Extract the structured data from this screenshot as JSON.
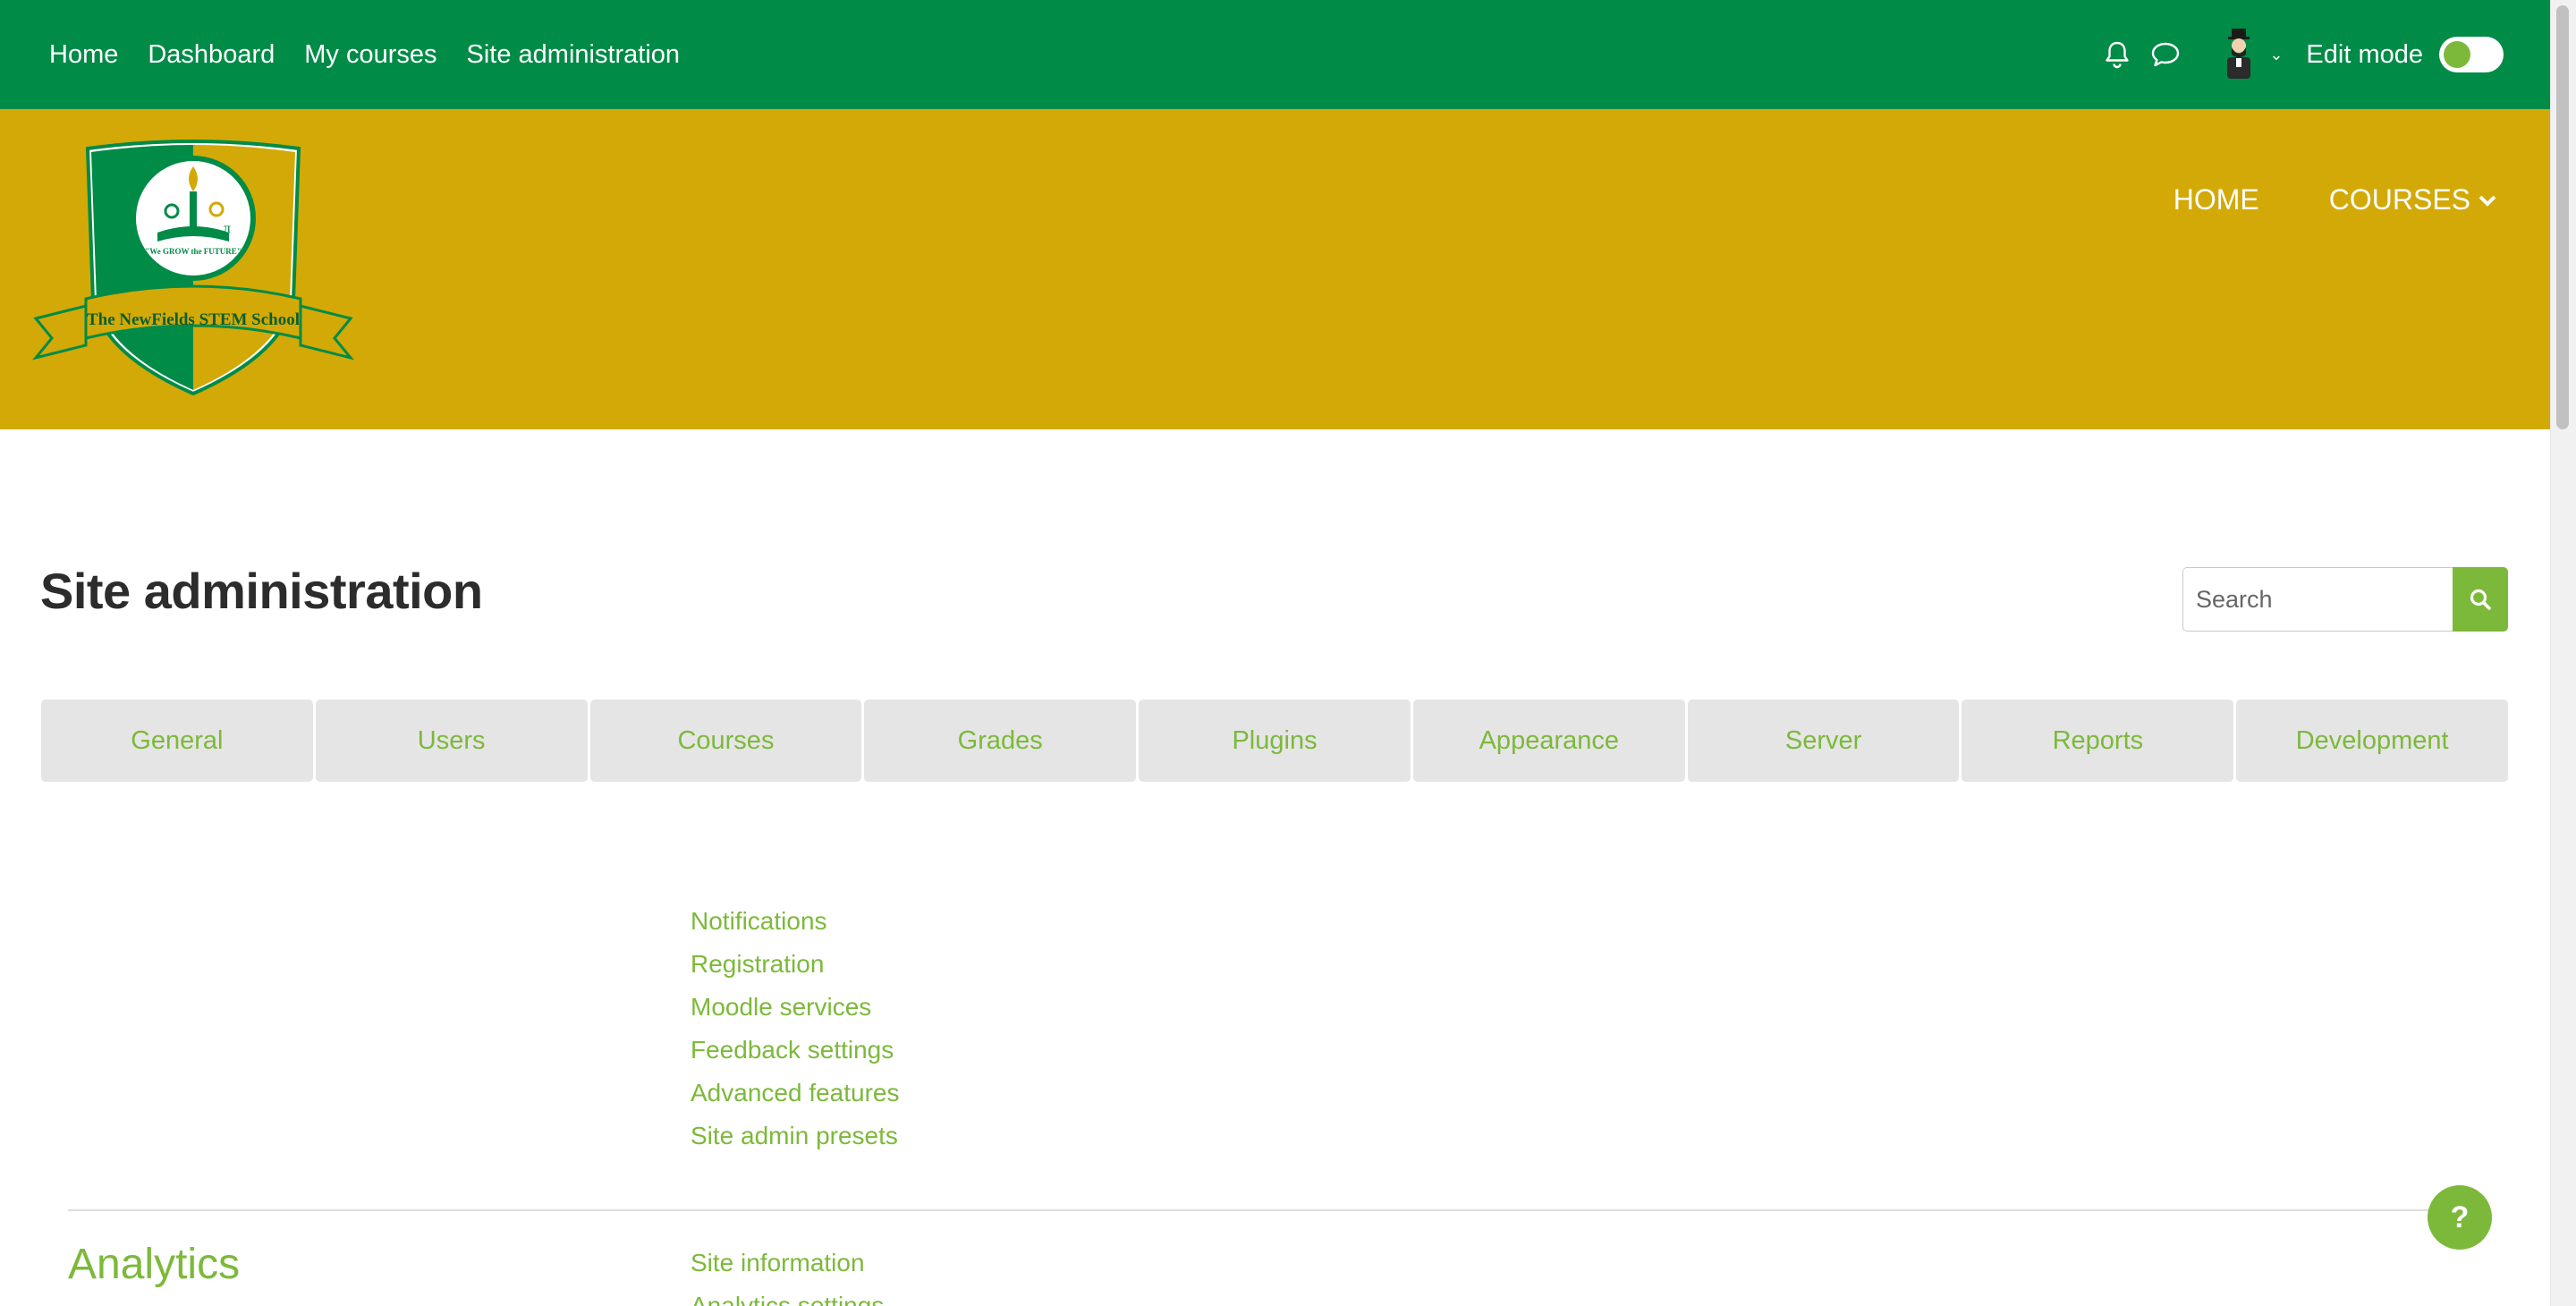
{
  "topnav": {
    "items": [
      "Home",
      "Dashboard",
      "My courses",
      "Site administration"
    ],
    "edit_mode_label": "Edit mode",
    "edit_mode_on": false
  },
  "banner": {
    "nav": [
      "HOME",
      "COURSES"
    ],
    "logo_text": "The NewFields STEM School",
    "logo_motto": "\"We GROW the FUTURE\""
  },
  "page": {
    "title": "Site administration",
    "search_placeholder": "Search"
  },
  "tabs": [
    "General",
    "Users",
    "Courses",
    "Grades",
    "Plugins",
    "Appearance",
    "Server",
    "Reports",
    "Development"
  ],
  "general_links": [
    "Notifications",
    "Registration",
    "Moodle services",
    "Feedback settings",
    "Advanced features",
    "Site admin presets"
  ],
  "analytics": {
    "title": "Analytics",
    "links": [
      "Site information",
      "Analytics settings"
    ]
  },
  "help_button": "?",
  "colors": {
    "navbar": "#008b47",
    "banner": "#d2a907",
    "accent": "#7cb93a",
    "tab_bg": "#e5e5e5"
  },
  "icons": [
    "bell-icon",
    "chat-icon",
    "avatar",
    "chevron-down-icon",
    "search-icon",
    "help-icon"
  ]
}
